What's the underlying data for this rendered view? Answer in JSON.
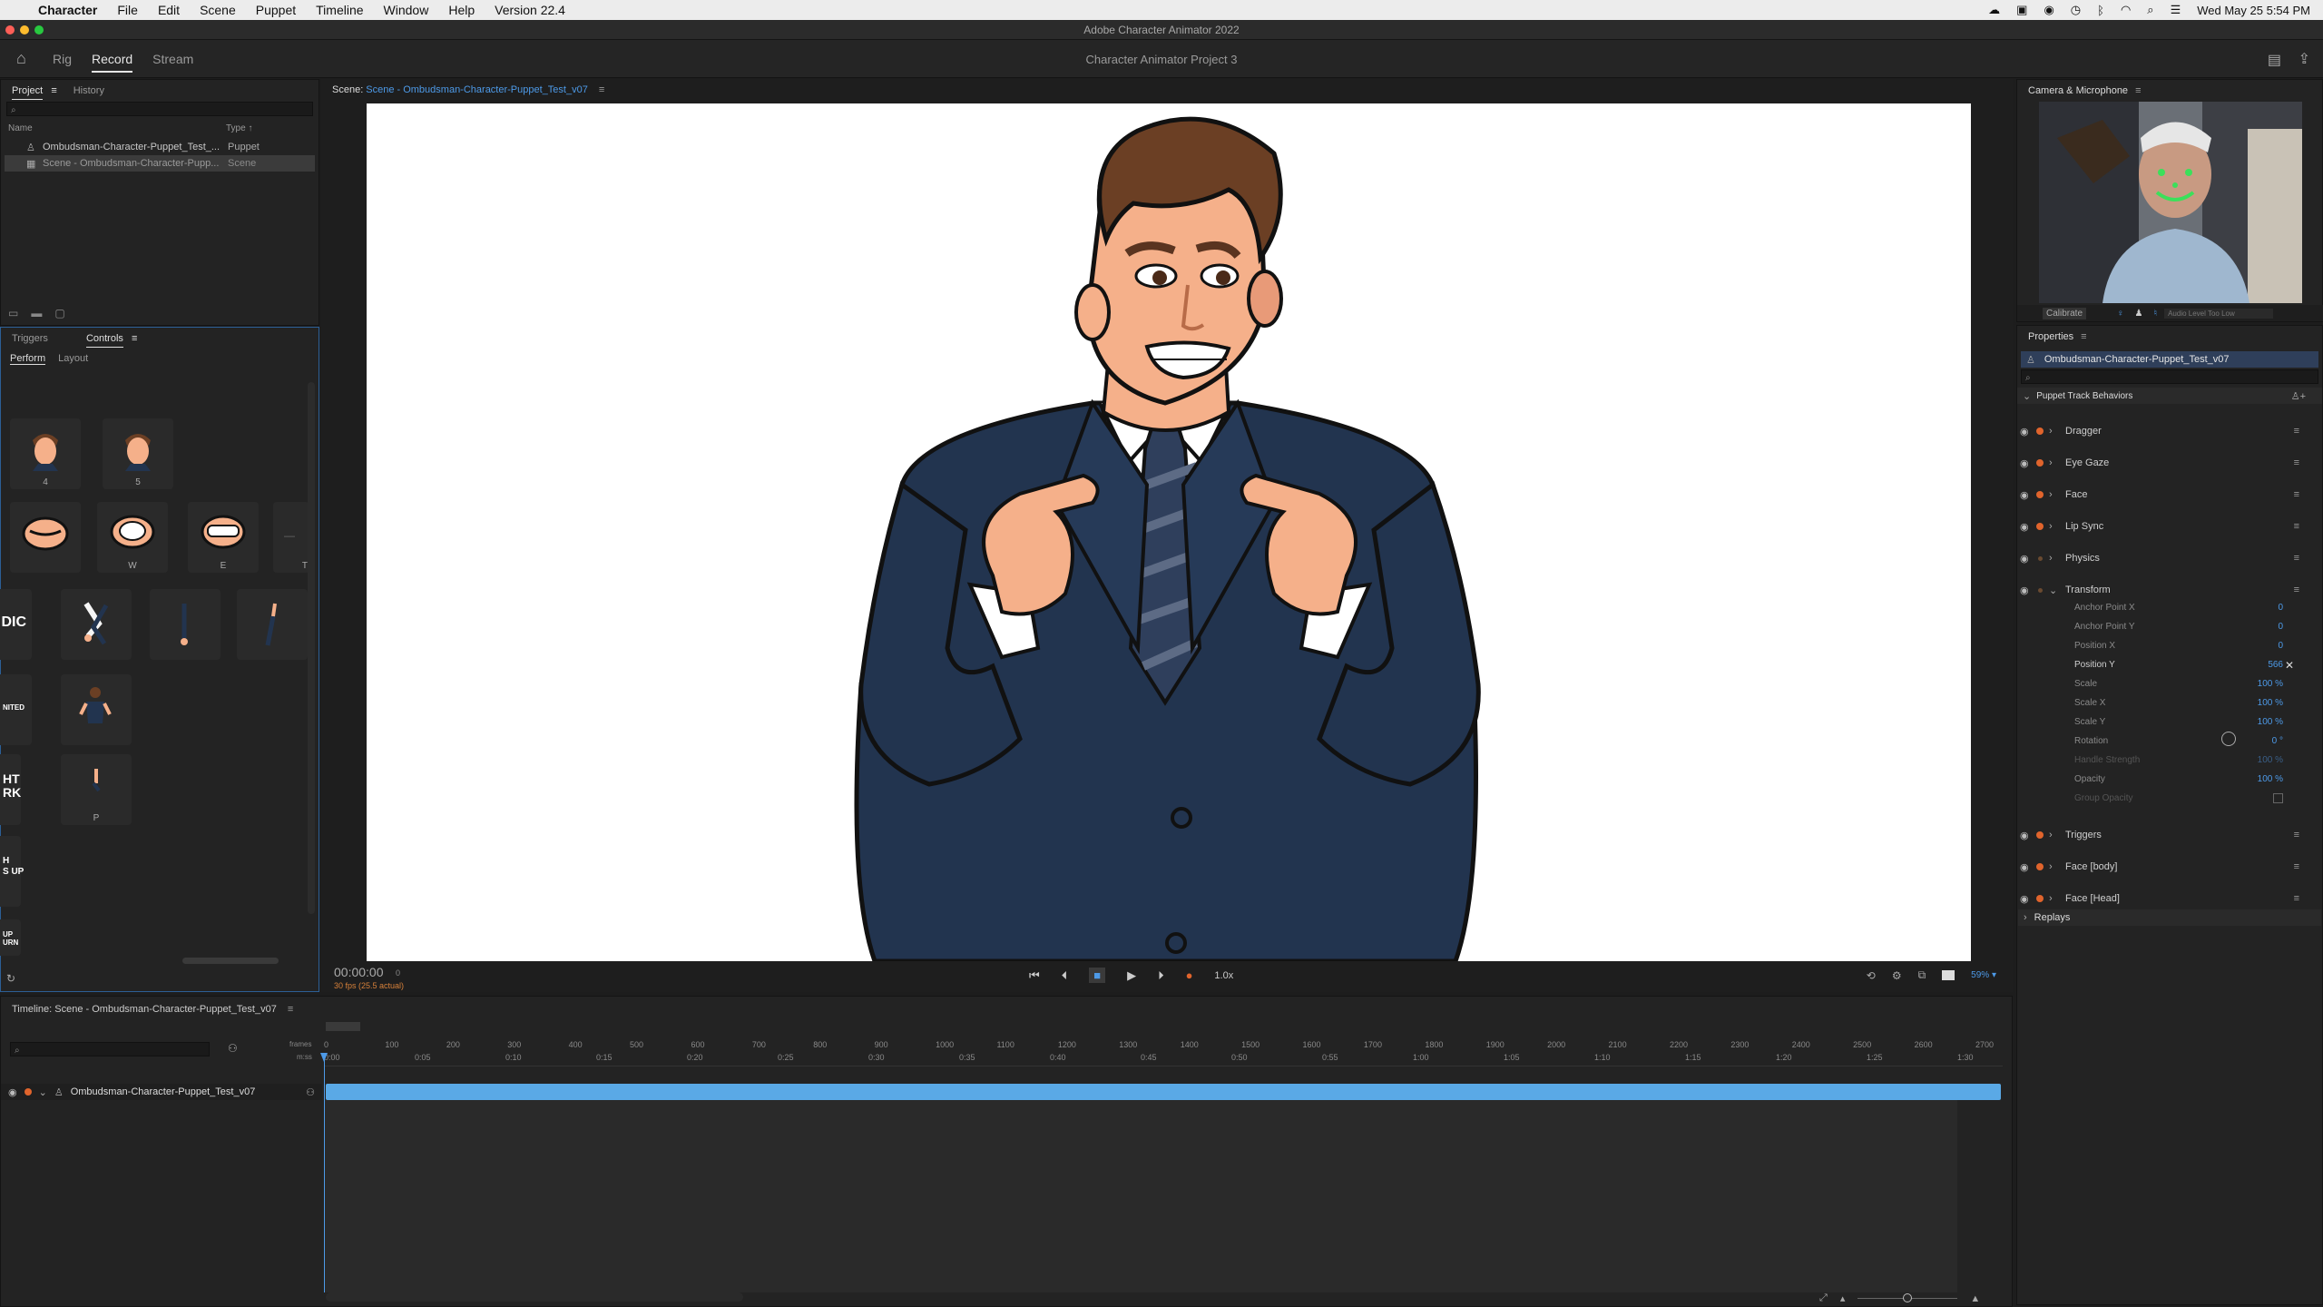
{
  "menubar": {
    "app": "Character",
    "items": [
      "File",
      "Edit",
      "Scene",
      "Puppet",
      "Timeline",
      "Window",
      "Help",
      "Version 22.4"
    ],
    "datetime": "Wed May 25  5:54 PM"
  },
  "window_title": "Adobe Character Animator 2022",
  "toolbar": {
    "modes": [
      "Rig",
      "Record",
      "Stream"
    ],
    "project_name": "Character Animator Project 3"
  },
  "project_panel": {
    "tabs": [
      "Project",
      "History"
    ],
    "col_name": "Name",
    "col_type": "Type",
    "rows": [
      {
        "name": "Ombudsman-Character-Puppet_Test_...",
        "type": "Puppet"
      },
      {
        "name": "Scene - Ombudsman-Character-Pupp...",
        "type": "Scene"
      }
    ]
  },
  "controls_panel": {
    "tabs": [
      "Triggers",
      "Controls"
    ],
    "subtabs": [
      "Perform",
      "Layout"
    ],
    "tile_labels": [
      "4",
      "5",
      "",
      "W",
      "E",
      "T",
      "",
      "",
      "",
      "",
      "",
      "P"
    ],
    "side_labels": [
      "DIC",
      "NITED",
      "HT\nRK",
      "H\nS UP",
      "UP\nURN"
    ]
  },
  "scene": {
    "label": "Scene:",
    "name": "Scene - Ombudsman-Character-Puppet_Test_v07"
  },
  "transport": {
    "timecode": "00:00:00",
    "frame": "0",
    "fps": "30 fps (25.5 actual)",
    "speed": "1.0x",
    "zoom": "59%"
  },
  "camera_panel": {
    "title": "Camera & Microphone",
    "calibrate": "Calibrate",
    "audio_status": "Audio Level Too Low"
  },
  "properties": {
    "title": "Properties",
    "selected": "Ombudsman-Character-Puppet_Test_v07",
    "section": "Puppet Track Behaviors",
    "behaviors_top": [
      "Dragger",
      "Eye Gaze",
      "Face",
      "Lip Sync",
      "Physics",
      "Transform"
    ],
    "transform_params": [
      {
        "name": "Anchor Point X",
        "value": "0"
      },
      {
        "name": "Anchor Point Y",
        "value": "0"
      },
      {
        "name": "Position X",
        "value": "0"
      },
      {
        "name": "Position Y",
        "value": "566"
      },
      {
        "name": "Scale",
        "value": "100 %"
      },
      {
        "name": "Scale X",
        "value": "100 %"
      },
      {
        "name": "Scale Y",
        "value": "100 %"
      },
      {
        "name": "Rotation",
        "value": "0 °"
      },
      {
        "name": "Handle Strength",
        "value": "100 %"
      },
      {
        "name": "Opacity",
        "value": "100 %"
      },
      {
        "name": "Group Opacity",
        "value": ""
      }
    ],
    "behaviors_bottom": [
      "Triggers",
      "Face [body]",
      "Face [Head]"
    ],
    "replays": "Replays"
  },
  "timeline": {
    "title": "Timeline: Scene - Ombudsman-Character-Puppet_Test_v07",
    "frames_label": "frames",
    "time_label": "m:ss",
    "frame_ticks": [
      "0",
      "100",
      "200",
      "300",
      "400",
      "500",
      "600",
      "700",
      "800",
      "900",
      "1000",
      "1100",
      "1200",
      "1300",
      "1400",
      "1500",
      "1600",
      "1700",
      "1800",
      "1900",
      "2000",
      "2100",
      "2200",
      "2300",
      "2400",
      "2500",
      "2600",
      "2700"
    ],
    "time_ticks": [
      "0:00",
      "0:05",
      "0:10",
      "0:15",
      "0:20",
      "0:25",
      "0:30",
      "0:35",
      "0:40",
      "0:45",
      "0:50",
      "0:55",
      "1:00",
      "1:05",
      "1:10",
      "1:15",
      "1:20",
      "1:25",
      "1:30"
    ],
    "track_name": "Ombudsman-Character-Puppet_Test_v07"
  },
  "colors": {
    "accent_blue": "#4d9ae8",
    "track_blue": "#5aa9e6",
    "record_red": "#e0642c",
    "suit": "#22344f",
    "skin": "#f5b08a",
    "hair": "#6b3f24"
  }
}
